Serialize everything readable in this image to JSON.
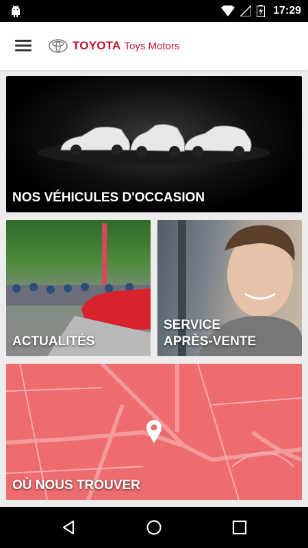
{
  "status_bar": {
    "time": "17:29",
    "icons": [
      "android-icon",
      "wifi-icon",
      "no-signal-icon",
      "battery-charging-icon"
    ]
  },
  "app_bar": {
    "menu_icon": "hamburger-menu-icon",
    "logo_icon": "toyota-emblem-icon",
    "brand_name": "TOYOTA",
    "dealer_name": "Toys Motors",
    "brand_color": "#c8102e"
  },
  "tiles": {
    "used_vehicles": {
      "label": "NOS VÉHICULES D'OCCASION"
    },
    "news": {
      "label": "ACTUALITÉS"
    },
    "after_sales": {
      "label_line1": "SERVICE",
      "label_line2": "APRÈS-VENTE"
    },
    "find_us": {
      "label": "OÙ NOUS TROUVER",
      "pin_icon": "map-pin-icon",
      "map_color": "#ee6b6e"
    }
  },
  "nav_bar": {
    "back_icon": "back-triangle-icon",
    "home_icon": "home-circle-icon",
    "recents_icon": "recents-square-icon"
  }
}
